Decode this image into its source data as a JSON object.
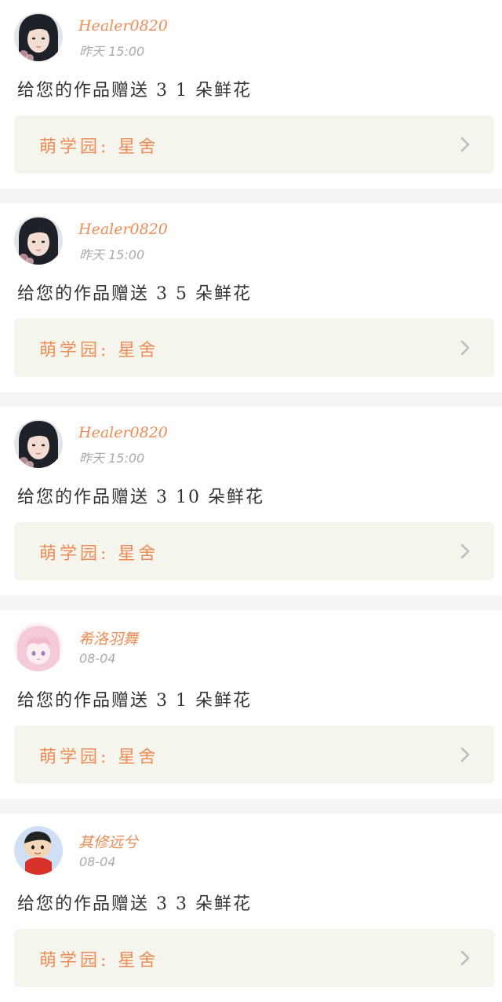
{
  "notifications": [
    {
      "username": "Healer0820",
      "time": "昨天 15:00",
      "message": "给您的作品赠送 3 1 朵鲜花",
      "target_label": "萌学园: 星舍",
      "avatar": "portrait-dark-hair"
    },
    {
      "username": "Healer0820",
      "time": "昨天 15:00",
      "message": "给您的作品赠送 3 5 朵鲜花",
      "target_label": "萌学园: 星舍",
      "avatar": "portrait-dark-hair"
    },
    {
      "username": "Healer0820",
      "time": "昨天 15:00",
      "message": "给您的作品赠送 3 10 朵鲜花",
      "target_label": "萌学园: 星舍",
      "avatar": "portrait-dark-hair"
    },
    {
      "username": "希洛羽舞",
      "time": "08-04",
      "message": "给您的作品赠送 3 1 朵鲜花",
      "target_label": "萌学园: 星舍",
      "avatar": "anime-pink-hair"
    },
    {
      "username": "其修远兮",
      "time": "08-04",
      "message": "给您的作品赠送 3 3 朵鲜花",
      "target_label": "萌学园: 星舍",
      "avatar": "cartoon-boy"
    }
  ],
  "colors": {
    "accent": "#ee8c55",
    "time": "#aaaaaa",
    "text": "#333333",
    "target_bg": "#f5f5ee",
    "separator": "#f5f5f5"
  },
  "icons": {
    "chevron": "chevron-right-icon"
  }
}
